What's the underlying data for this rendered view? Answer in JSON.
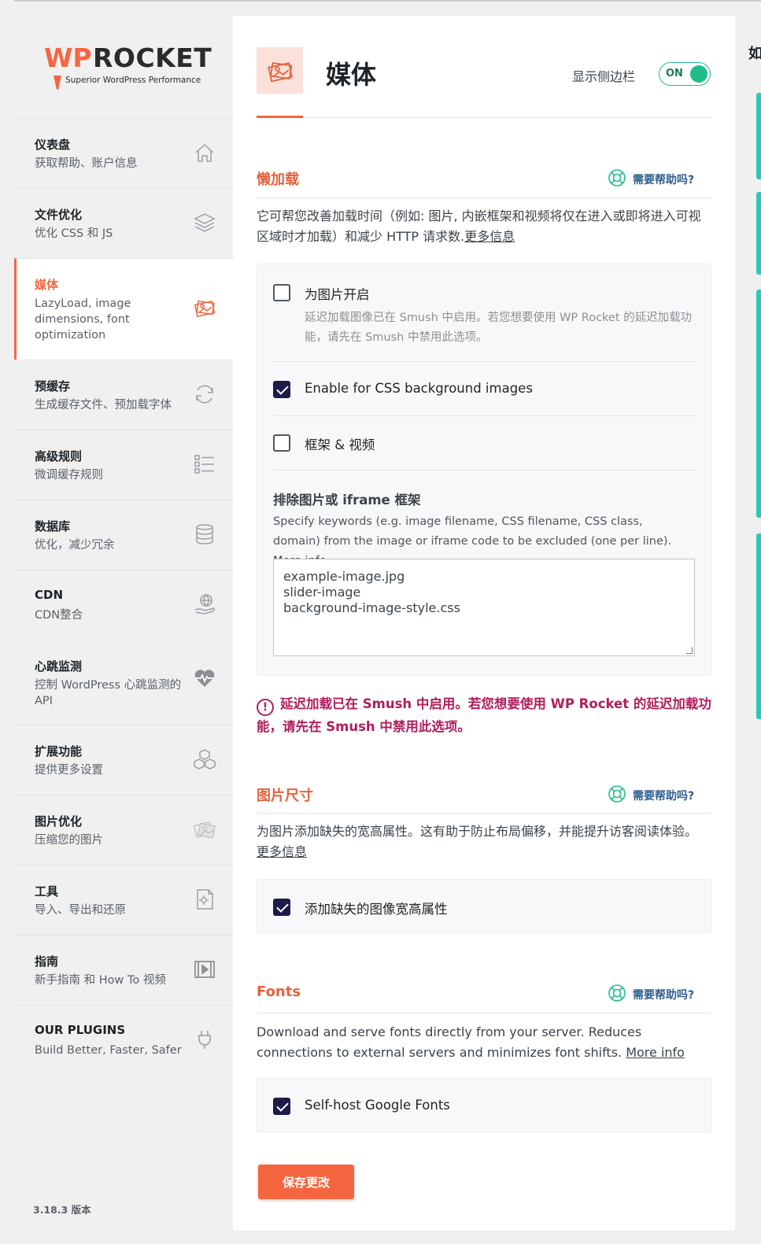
{
  "brand": {
    "wp": "WP",
    "rocket": "ROCKET",
    "tagline": "Superior WordPress Performance",
    "accent_color": "#f56640"
  },
  "sidebar": {
    "items": [
      {
        "title": "仪表盘",
        "subtitle": "获取帮助、账户信息",
        "icon": "home-icon"
      },
      {
        "title": "文件优化",
        "subtitle": "优化 CSS 和 JS",
        "icon": "layers-icon"
      },
      {
        "title": "媒体",
        "subtitle": "LazyLoad, image dimensions, font optimization",
        "icon": "images-icon",
        "active": true
      },
      {
        "title": "预缓存",
        "subtitle": "生成缓存文件、预加载字体",
        "icon": "refresh-icon"
      },
      {
        "title": "高级规则",
        "subtitle": "微调缓存规则",
        "icon": "list-icon"
      },
      {
        "title": "数据库",
        "subtitle": "优化，减少冗余",
        "icon": "database-icon"
      },
      {
        "title": "CDN",
        "subtitle": "CDN整合",
        "icon": "globe-hand-icon"
      },
      {
        "title": "心跳监测",
        "subtitle": "控制 WordPress 心跳监测的 API",
        "icon": "heartbeat-icon"
      },
      {
        "title": "扩展功能",
        "subtitle": "提供更多设置",
        "icon": "cubes-icon"
      },
      {
        "title": "图片优化",
        "subtitle": "压缩您的图片",
        "icon": "photos-icon"
      },
      {
        "title": "工具",
        "subtitle": "导入、导出和还原",
        "icon": "file-gear-icon"
      },
      {
        "title": "指南",
        "subtitle": "新手指南 和 How To 视频",
        "icon": "video-icon"
      },
      {
        "title": "OUR PLUGINS",
        "subtitle": "Build Better, Faster, Safer",
        "icon": "plug-icon"
      }
    ],
    "version": "3.18.3 版本"
  },
  "header": {
    "title": "媒体",
    "sidebar_toggle_label": "显示侧边栏",
    "toggle_state": "ON"
  },
  "lazyload": {
    "title": "懒加载",
    "help": "需要帮助吗?",
    "description": "它可帮您改善加载时间（例如: 图片, 内嵌框架和视频将仅在进入或即将进入可视区域时才加载）和减少 HTTP 请求数.",
    "more": "更多信息",
    "option_images": {
      "label": "为图片开启",
      "hint": "延迟加载图像已在 Smush 中启用。若您想要使用 WP Rocket 的延迟加载功能，请先在 Smush 中禁用此选项。",
      "checked": false
    },
    "option_css_bg": {
      "label": "Enable for CSS background images",
      "checked": true
    },
    "option_iframes": {
      "label": "框架 & 视频",
      "checked": false
    },
    "exclude_title": "排除图片或 iframe 框架",
    "exclude_desc": "Specify keywords (e.g. image filename, CSS filename, CSS class, domain) from the image or iframe code to be excluded (one per line).",
    "exclude_more": "More info",
    "exclude_lines": [
      "example-image.jpg",
      "slider-image",
      "background-image-style.css"
    ],
    "warning": "延迟加载已在 Smush 中启用。若您想要使用 WP Rocket 的延迟加载功能，请先在 Smush 中禁用此选项。"
  },
  "dimensions": {
    "title": "图片尺寸",
    "help": "需要帮助吗?",
    "description": "为图片添加缺失的宽高属性。这有助于防止布局偏移，并能提升访客阅读体验。",
    "more": "更多信息",
    "option": {
      "label": "添加缺失的图像宽高属性",
      "checked": true
    }
  },
  "fonts": {
    "title": "Fonts",
    "help": "需要帮助吗?",
    "description": "Download and serve fonts directly from your server. Reduces connections to external servers and minimizes font shifts.",
    "more": "More info",
    "option": {
      "label": "Self-host Google Fonts",
      "checked": true
    }
  },
  "save_label": "保存更改",
  "edge_char": "如"
}
